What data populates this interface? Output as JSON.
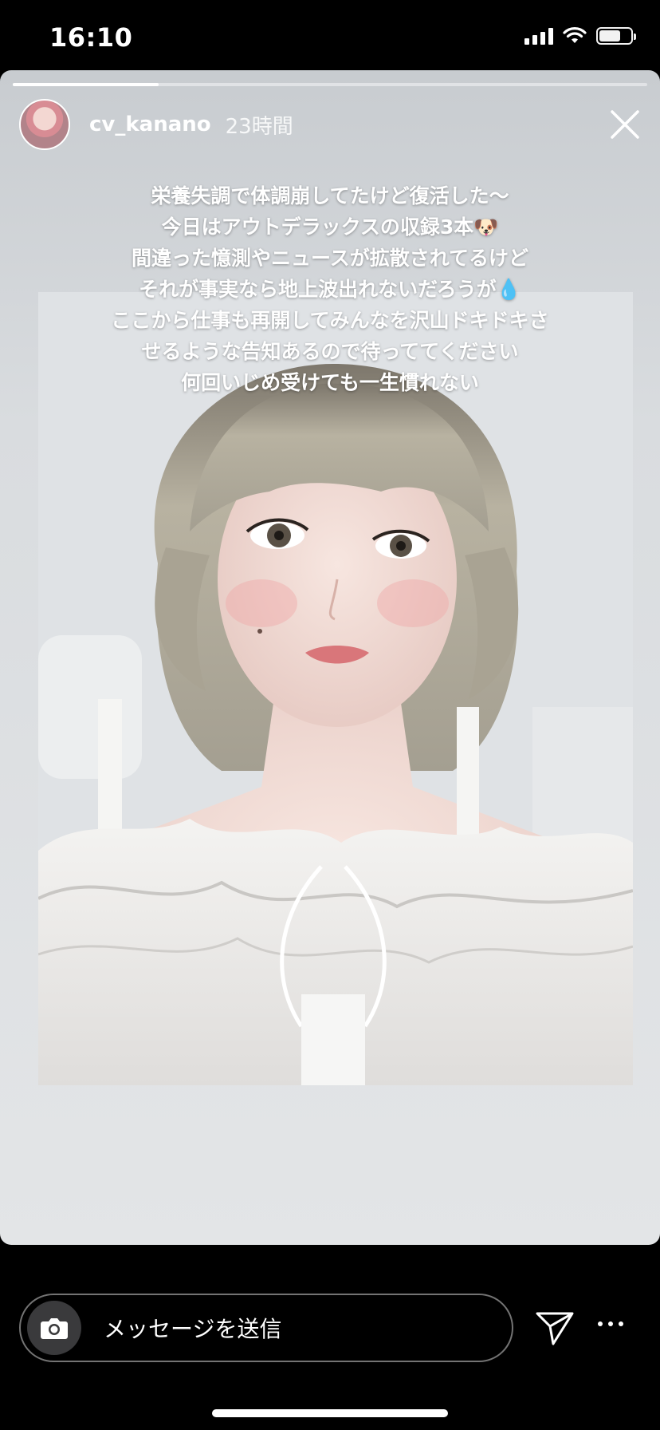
{
  "status_bar": {
    "time": "16:10"
  },
  "story": {
    "progress": 0.23,
    "username": "cv_kanano",
    "time_ago": "23時間",
    "caption_lines": [
      "栄養失調で体調崩してたけど復活した〜",
      "今日はアウトデラックスの収録3本🐶",
      "間違った憶測やニュースが拡散されてるけど",
      "それが事実なら地上波出れないだろうが💧",
      "ここから仕事も再開してみんなを沢山ドキドキさ",
      "せるような告知あるので待っててください",
      "何回いじめ受けても一生慣れない"
    ]
  },
  "bottom_bar": {
    "message_placeholder": "メッセージを送信"
  },
  "icons": {
    "close": "close-icon",
    "camera": "camera-icon",
    "send": "paper-plane-icon",
    "more": "more-dots-icon"
  }
}
